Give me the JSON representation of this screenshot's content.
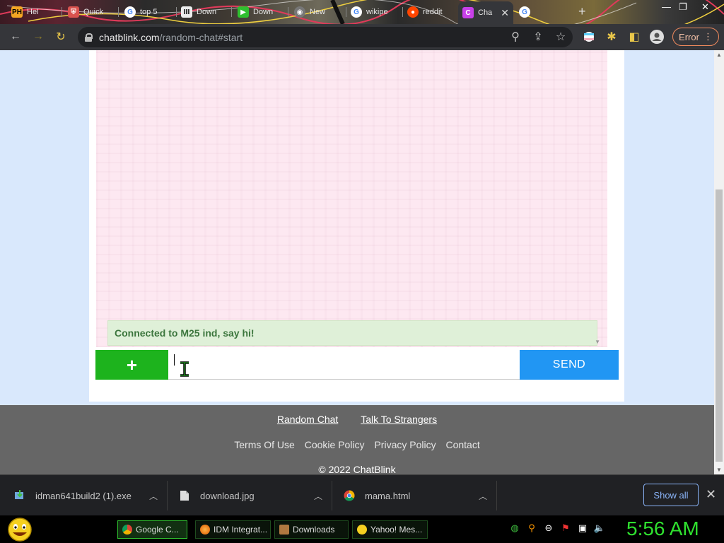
{
  "browser": {
    "tabs": [
      {
        "label": "Hel",
        "favicon": "PH",
        "color": "#f5a623"
      },
      {
        "label": "Quick",
        "favicon": "shield",
        "color": "#d9534f"
      },
      {
        "label": "top 5",
        "favicon": "google",
        "color": "#4285f4"
      },
      {
        "label": "Down",
        "favicon": "columns",
        "color": "#333333"
      },
      {
        "label": "Down",
        "favicon": "flag",
        "color": "#2fbf2f"
      },
      {
        "label": "New",
        "favicon": "chrome",
        "color": "#999999"
      },
      {
        "label": "wikipe",
        "favicon": "google",
        "color": "#4285f4"
      },
      {
        "label": "reddit",
        "favicon": "reddit",
        "color": "#ff4500"
      },
      {
        "label": "Cha",
        "favicon": "C",
        "color": "#c840e9",
        "active": true
      },
      {
        "label": "",
        "favicon": "google",
        "color": "#4285f4"
      }
    ],
    "url_host": "chatblink.com",
    "url_path": "/random-chat#start",
    "error_label": "Error"
  },
  "chat": {
    "status_message": "Connected to M25 ind, say hi!",
    "input_value": "",
    "plus_label": "+",
    "send_label": "SEND"
  },
  "footer": {
    "links_primary": [
      "Random Chat",
      "Talk To Strangers"
    ],
    "links_secondary": [
      "Terms Of Use",
      "Cookie Policy",
      "Privacy Policy",
      "Contact"
    ],
    "copyright": "© 2022 ChatBlink"
  },
  "downloads": {
    "items": [
      {
        "name": "idman641build2 (1).exe",
        "icon": "installer-icon"
      },
      {
        "name": "download.jpg",
        "icon": "image-file-icon"
      },
      {
        "name": "mama.html",
        "icon": "chrome-icon"
      }
    ],
    "show_all_label": "Show all"
  },
  "taskbar": {
    "tasks": [
      {
        "label": "Google C...",
        "icon": "chrome",
        "active": true
      },
      {
        "label": "IDM Integrat...",
        "icon": "firefox",
        "active": false
      },
      {
        "label": "Downloads",
        "icon": "folder",
        "active": false
      },
      {
        "label": "Yahoo! Mes...",
        "icon": "yahoo",
        "active": false
      }
    ],
    "clock": "5:56 AM"
  }
}
